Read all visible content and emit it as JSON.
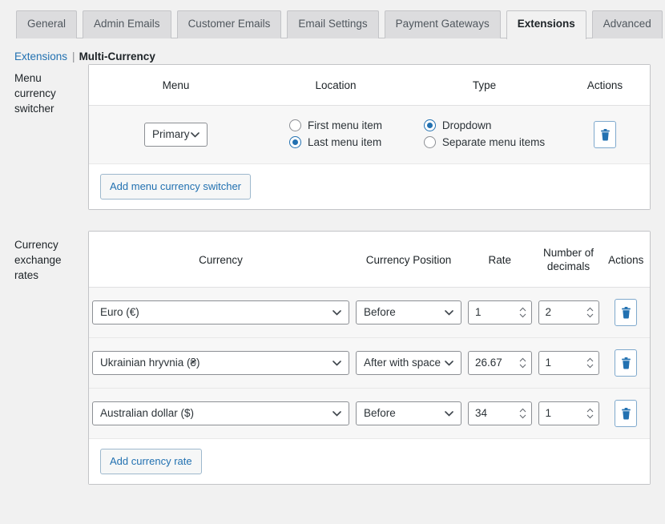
{
  "tabs": [
    {
      "label": "General",
      "active": false
    },
    {
      "label": "Admin Emails",
      "active": false
    },
    {
      "label": "Customer Emails",
      "active": false
    },
    {
      "label": "Email Settings",
      "active": false
    },
    {
      "label": "Payment Gateways",
      "active": false
    },
    {
      "label": "Extensions",
      "active": true
    },
    {
      "label": "Advanced",
      "active": false
    }
  ],
  "breadcrumb": {
    "parent": "Extensions",
    "separator": "|",
    "current": "Multi-Currency"
  },
  "menu_switcher": {
    "row_label": "Menu currency switcher",
    "headers": [
      "Menu",
      "Location",
      "Type",
      "Actions"
    ],
    "rows": [
      {
        "menu_select": "Primary",
        "location_options": [
          {
            "label": "First menu item",
            "checked": false
          },
          {
            "label": "Last menu item",
            "checked": true
          }
        ],
        "type_options": [
          {
            "label": "Dropdown",
            "checked": true
          },
          {
            "label": "Separate menu items",
            "checked": false
          }
        ],
        "delete_icon": "trash-icon"
      }
    ],
    "add_button": "Add menu currency switcher"
  },
  "exchange_rates": {
    "row_label": "Currency exchange rates",
    "headers": {
      "currency": "Currency",
      "position": "Currency Position",
      "rate": "Rate",
      "decimals_line1": "Number of",
      "decimals_line2": "decimals",
      "actions": "Actions"
    },
    "rows": [
      {
        "currency": "Euro (€)",
        "position": "Before",
        "rate": "1",
        "decimals": "2",
        "delete_icon": "trash-icon"
      },
      {
        "currency": "Ukrainian hryvnia (₴)",
        "position": "After with space",
        "rate": "26.67",
        "decimals": "1",
        "delete_icon": "trash-icon"
      },
      {
        "currency": "Australian dollar ($)",
        "position": "Before",
        "rate": "34",
        "decimals": "1",
        "delete_icon": "trash-icon"
      }
    ],
    "add_button": "Add currency rate"
  },
  "colors": {
    "link": "#2271b1",
    "page_bg": "#f1f1f1",
    "panel_bg": "#ffffff",
    "row_bg": "#f7f7f7",
    "border": "#c3c4c7",
    "trash": "#2271b1"
  }
}
